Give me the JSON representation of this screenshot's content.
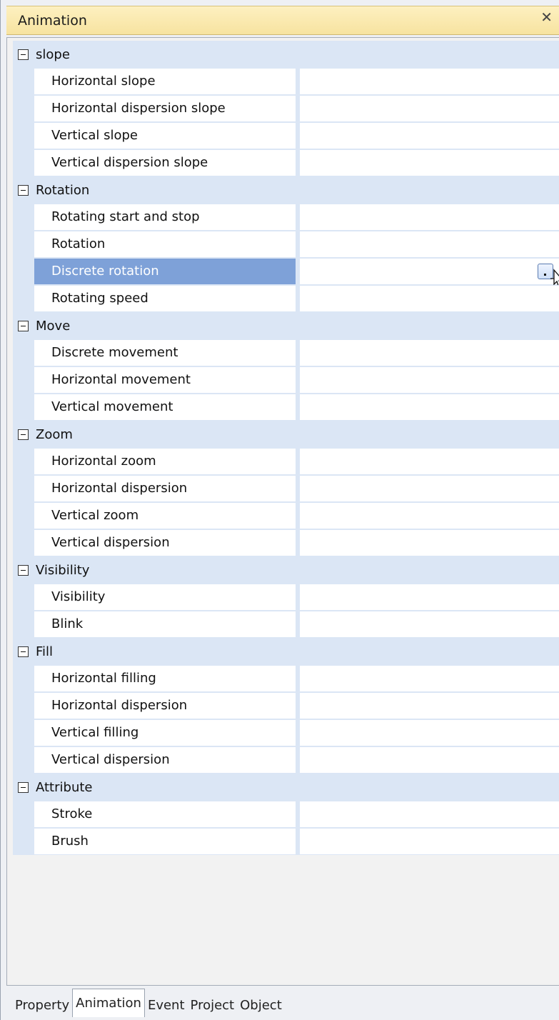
{
  "panel": {
    "title": "Animation",
    "close_symbol": "✕"
  },
  "categories": [
    {
      "label": "slope",
      "expanded": true,
      "items": [
        "Horizontal slope",
        "Horizontal dispersion slope",
        "Vertical slope",
        "Vertical dispersion slope"
      ]
    },
    {
      "label": "Rotation",
      "expanded": true,
      "items": [
        "Rotating start and stop",
        "Rotation",
        "Discrete rotation",
        "Rotating speed"
      ]
    },
    {
      "label": "Move",
      "expanded": true,
      "items": [
        "Discrete movement",
        "Horizontal movement",
        "Vertical movement"
      ]
    },
    {
      "label": "Zoom",
      "expanded": true,
      "items": [
        "Horizontal zoom",
        "Horizontal dispersion",
        "Vertical zoom",
        "Vertical dispersion"
      ]
    },
    {
      "label": "Visibility",
      "expanded": true,
      "items": [
        "Visibility",
        "Blink"
      ]
    },
    {
      "label": "Fill",
      "expanded": true,
      "items": [
        "Horizontal filling",
        "Horizontal dispersion",
        "Vertical filling",
        "Vertical dispersion"
      ]
    },
    {
      "label": "Attribute",
      "expanded": true,
      "items": [
        "Stroke",
        "Brush"
      ]
    }
  ],
  "selected_property": "Discrete rotation",
  "tabs": [
    {
      "label": "Property",
      "active": false
    },
    {
      "label": "Animation",
      "active": true
    },
    {
      "label": "Event",
      "active": false
    },
    {
      "label": "Project",
      "active": false
    },
    {
      "label": "Object",
      "active": false
    }
  ],
  "icons": {
    "collapse": "minus-box-icon",
    "ellipsis": "ellipsis-button-icon",
    "cursor": "pointer-cursor-icon"
  },
  "colors": {
    "title_bg": "#f7e3a0",
    "category_bg": "#dbe6f5",
    "selection": "#7ea1d8"
  }
}
